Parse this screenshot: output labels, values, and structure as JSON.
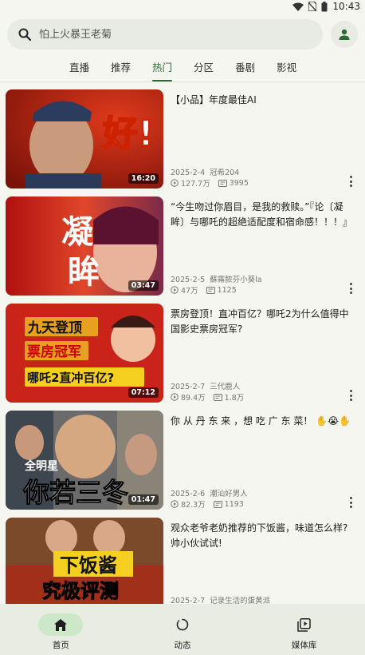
{
  "status": {
    "time": "10:43"
  },
  "search": {
    "placeholder": "怕上火暴王老菊"
  },
  "tabs": [
    {
      "label": "直播",
      "active": false
    },
    {
      "label": "推荐",
      "active": false
    },
    {
      "label": "热门",
      "active": true
    },
    {
      "label": "分区",
      "active": false
    },
    {
      "label": "番剧",
      "active": false
    },
    {
      "label": "影视",
      "active": false
    }
  ],
  "videos": [
    {
      "title": "【小品】年度最佳AI",
      "date": "2025-2-4",
      "author": "冠希204",
      "views": "127.7万",
      "danmaku": "3995",
      "duration": "16:20",
      "thumb_text": [
        "好!"
      ]
    },
    {
      "title": "“今生吻过你眉目，是我的救赎。”『论〔凝眸〕与哪吒的超绝适配度和宿命感！！！』",
      "date": "2025-2-5",
      "author": "蘇霧脓芬小葵la",
      "views": "47万",
      "danmaku": "1125",
      "duration": "03:47",
      "thumb_text": [
        "凝",
        "眸"
      ]
    },
    {
      "title": "票房登顶！直冲百亿？哪吒2为什么值得中国影史票房冠军?",
      "date": "2025-2-7",
      "author": "三代鹿人",
      "views": "89.4万",
      "danmaku": "1.8万",
      "duration": "07:12",
      "thumb_text": [
        "九天登顶",
        "票房冠军",
        "哪吒2直冲百亿?"
      ]
    },
    {
      "title": "你 从 丹 东 来 ，想 吃 广 东 菜！ ✋😭✋",
      "date": "2025-2-6",
      "author": "潮汕好男人",
      "views": "82.3万",
      "danmaku": "1193",
      "duration": "01:47",
      "thumb_text": [
        "全明星",
        "你若三冬"
      ]
    },
    {
      "title": "观众老爷老奶推荐的下饭酱，味道怎么样?帅小伙试试!",
      "date": "2025-2-7",
      "author": "记录生活的蛋黄派",
      "views": "",
      "danmaku": "",
      "duration": "",
      "thumb_text": [
        "下饭酱",
        "究极评测"
      ]
    }
  ],
  "bottom_nav": [
    {
      "label": "首页",
      "icon": "home-icon",
      "active": true
    },
    {
      "label": "动态",
      "icon": "activity-icon",
      "active": false
    },
    {
      "label": "媒体库",
      "icon": "library-icon",
      "active": false
    }
  ],
  "colors": {
    "accent": "#2e6a36",
    "active_pill": "#cde8c8",
    "background": "#f4f6ef"
  }
}
